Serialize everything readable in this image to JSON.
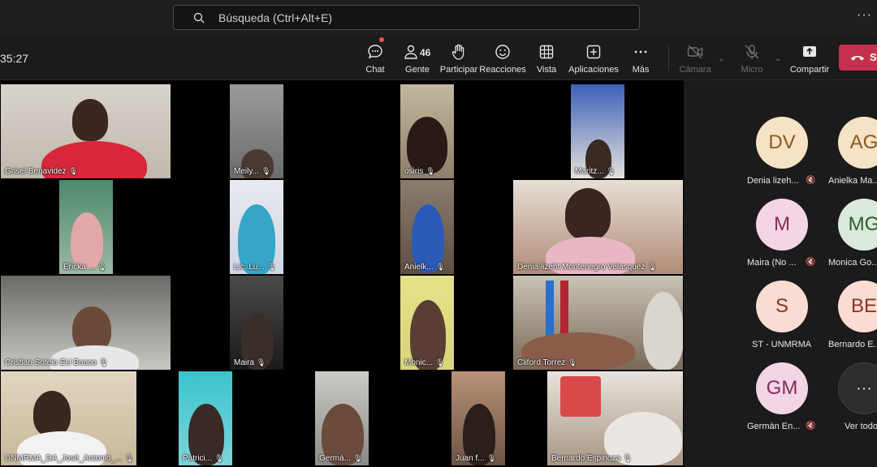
{
  "search": {
    "placeholder": "Búsqueda (Ctrl+Alt+E)"
  },
  "title_more": "···",
  "meeting": {
    "timer": "35:27",
    "people_count": "46",
    "buttons": {
      "chat": "Chat",
      "people": "Gente",
      "raise_hand": "Participar",
      "reactions": "Reacciones",
      "view": "Vista",
      "apps": "Aplicaciones",
      "more": "Más",
      "camera": "Cámara",
      "mic": "Micro",
      "share": "Compartir",
      "leave": "S"
    }
  },
  "colors": {
    "leave_red": "#c4314b",
    "chat_badge": "#e25b4b"
  },
  "video_tiles": [
    {
      "name": "Grisel Benavidez"
    },
    {
      "name": "Meily..."
    },
    {
      "name": "osiris"
    },
    {
      "name": "Maritz..."
    },
    {
      "name": "Ericka ..."
    },
    {
      "name": "Lic. Lu..."
    },
    {
      "name": "Anielk..."
    },
    {
      "name": "Denia lizeht Montenegro Velasquez"
    },
    {
      "name": "Cristian Sotelo EU  Boaco"
    },
    {
      "name": "Maira"
    },
    {
      "name": "Monic..."
    },
    {
      "name": "Cliford Torrez"
    },
    {
      "name": "UNMRMA_DA_José_Antonio_..."
    },
    {
      "name": "Patrici..."
    },
    {
      "name": "Germá..."
    },
    {
      "name": "Juan f..."
    },
    {
      "name": "Bernardo Espinoza"
    }
  ],
  "roster": [
    {
      "initials": "DV",
      "name": "Denia lizeh...",
      "color": "#f6e2c6",
      "text": "#8a5a1c"
    },
    {
      "initials": "AG",
      "name": "Anielka Ma...",
      "color": "#f6e2c6",
      "text": "#8a5a1c"
    },
    {
      "initials": "M",
      "name": "Maira (No ...",
      "color": "#f3d6e6",
      "text": "#8c2a5a"
    },
    {
      "initials": "MG",
      "name": "Monica Go...",
      "color": "#dbe8dc",
      "text": "#2e5a33"
    },
    {
      "initials": "S",
      "name": "ST - UNMRMA",
      "color": "#fbdcd3",
      "text": "#8a3322"
    },
    {
      "initials": "BE",
      "name": "Bernardo E...",
      "color": "#fbdcd3",
      "text": "#8a3322"
    },
    {
      "initials": "GM",
      "name": "Germàn En...",
      "color": "#f3d6e6",
      "text": "#8c2a5a"
    }
  ],
  "see_all": "Ver todo"
}
